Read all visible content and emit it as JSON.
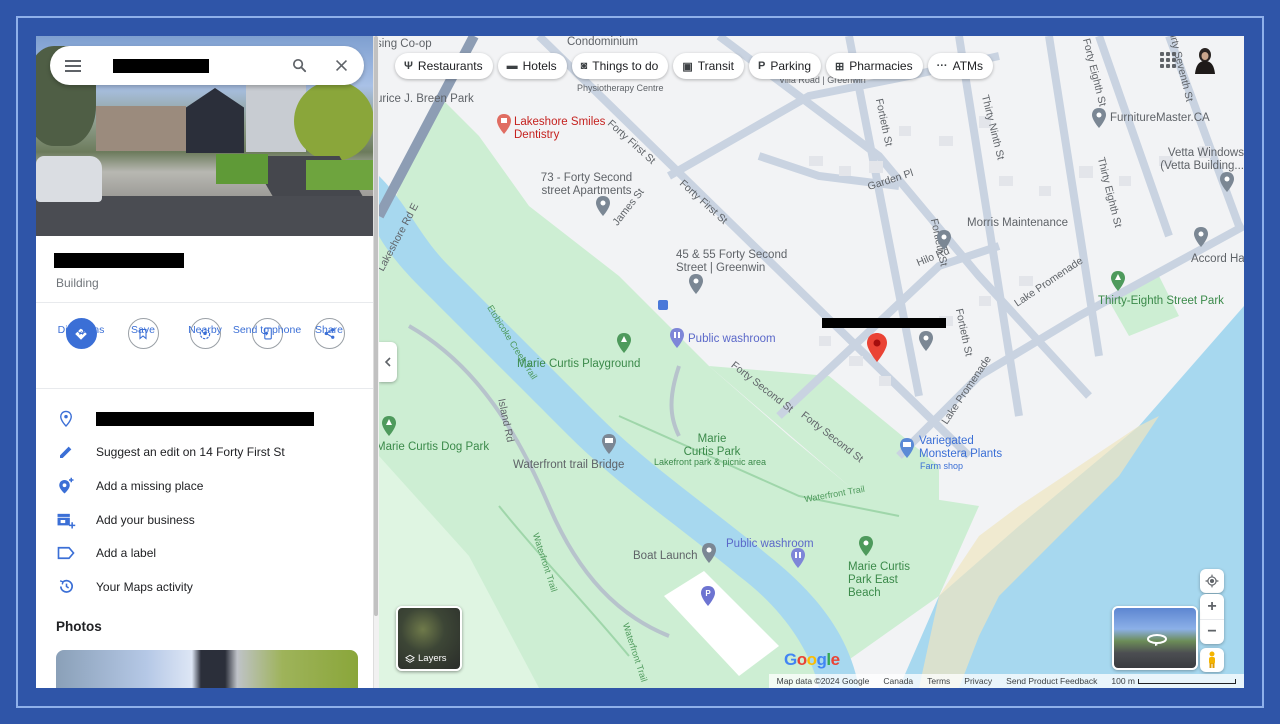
{
  "search": {
    "query_redacted": true
  },
  "place": {
    "title_redacted": true,
    "type": "Building"
  },
  "actions": [
    {
      "label": "Directions",
      "icon": "directions-icon"
    },
    {
      "label": "Save",
      "icon": "bookmark-icon"
    },
    {
      "label": "Nearby",
      "icon": "nearby-icon"
    },
    {
      "label": "Send to phone",
      "icon": "send-to-phone-icon"
    },
    {
      "label": "Share",
      "icon": "share-icon"
    }
  ],
  "info_items": [
    {
      "icon": "location-pin-icon",
      "text": "",
      "redacted": true
    },
    {
      "icon": "pencil-icon",
      "text": "Suggest an edit on 14 Forty First St"
    },
    {
      "icon": "add-place-icon",
      "text": "Add a missing place"
    },
    {
      "icon": "add-business-icon",
      "text": "Add your business"
    },
    {
      "icon": "label-icon",
      "text": "Add a label"
    },
    {
      "icon": "history-icon",
      "text": "Your Maps activity"
    }
  ],
  "photos_title": "Photos",
  "chips": [
    {
      "icon": "restaurant-icon",
      "glyph": "Ψ",
      "label": "Restaurants"
    },
    {
      "icon": "hotel-icon",
      "glyph": "▬",
      "label": "Hotels"
    },
    {
      "icon": "camera-icon",
      "glyph": "◙",
      "label": "Things to do"
    },
    {
      "icon": "transit-icon",
      "glyph": "▣",
      "label": "Transit"
    },
    {
      "icon": "parking-icon",
      "glyph": "P",
      "label": "Parking"
    },
    {
      "icon": "pharmacy-icon",
      "glyph": "⊞",
      "label": "Pharmacies"
    },
    {
      "icon": "atm-icon",
      "glyph": "···",
      "label": "ATMs"
    }
  ],
  "map_labels": {
    "housing_coop": "sing Co-op",
    "condominium": "Condominium",
    "breen_park": "urice J. Breen Park",
    "physio": "Physiotherapy Centre",
    "villa_rd": "Villa Road | Greenwin",
    "lakeshore_smiles": "Lakeshore Smiles Dentistry",
    "forty_first_st": "Forty First St",
    "apartments_73": "73 - Forty Second street Apartments",
    "james_st": "James St",
    "lakeshore_rd": "Lakeshore Rd E",
    "garden_pl": "Garden Pl",
    "fortieth_st": "Fortieth St",
    "morris": "Morris Maintenance",
    "furniture": "FurnitureMaster.CA",
    "vetta": "Vetta Windows (Vetta Building...",
    "thirty_ninth": "Thirty Ninth St",
    "thirty_eighth": "Thirty Eighth St",
    "thirty_seventh": "Thirty Seventh St",
    "forty_eighth": "Forty Eighth St",
    "accord": "Accord Hart",
    "lake_promenade": "Lake Promenade",
    "thirty_eighth_park": "Thirty-Eighth Street Park",
    "greenwin_4555": "45 & 55 Forty Second Street | Greenwin",
    "hilo_rd": "Hilo Rd",
    "etobicoke_trail": "Etobicoke Creek Trail",
    "public_washroom": "Public washroom",
    "playground": "Marie Curtis Playground",
    "forty_second_st": "Forty Second St",
    "dog_park": "Marie Curtis Dog Park",
    "island_rd": "Island Rd",
    "trail_bridge": "Waterfront trail Bridge",
    "marie_curtis_park": "Marie Curtis Park",
    "park_sub": "Lakefront park & picnic area",
    "waterfront_trail": "Waterfront Trail",
    "monstera": "Variegated Monstera Plants",
    "farm_shop": "Farm shop",
    "boat_launch": "Boat Launch",
    "public_washroom_2": "Public washroom",
    "east_beach": "Marie Curtis Park East Beach"
  },
  "layers_label": "Layers",
  "footer": {
    "map_data": "Map data ©2024 Google",
    "region": "Canada",
    "terms": "Terms",
    "privacy": "Privacy",
    "feedback": "Send Product Feedback",
    "scale": "100 m"
  },
  "colors": {
    "accent": "#3b6fd6",
    "frame": "#2f55a8",
    "water": "#a7d8ef",
    "park": "#c9ecd0",
    "selected_pin": "#ea4335"
  }
}
